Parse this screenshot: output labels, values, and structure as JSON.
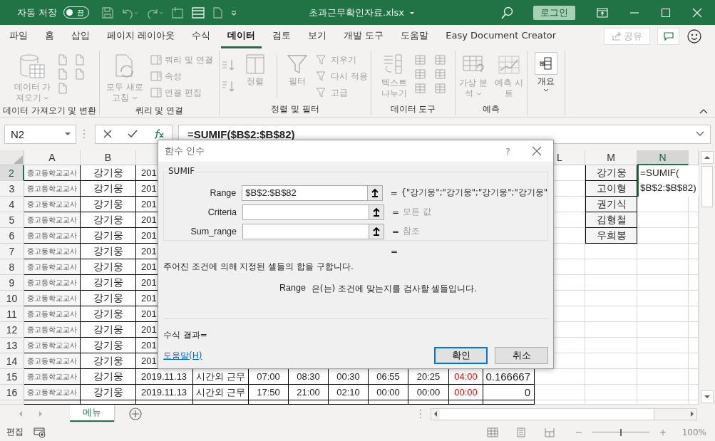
{
  "title_bar": {
    "autosave_label": "자동 저장",
    "autosave_toggle": {
      "label": "끔",
      "on": false
    },
    "file_name": "초과근무확인자료.xlsx",
    "sign_in": "로그인"
  },
  "tabs": [
    {
      "label": "파일",
      "selected": false
    },
    {
      "label": "홈",
      "selected": false
    },
    {
      "label": "삽입",
      "selected": false
    },
    {
      "label": "페이지 레이아웃",
      "selected": false
    },
    {
      "label": "수식",
      "selected": false
    },
    {
      "label": "데이터",
      "selected": true
    },
    {
      "label": "검토",
      "selected": false
    },
    {
      "label": "보기",
      "selected": false
    },
    {
      "label": "개발 도구",
      "selected": false
    },
    {
      "label": "도움말",
      "selected": false
    },
    {
      "label": "Easy Document Creator",
      "selected": false
    }
  ],
  "share_button": {
    "label": "공유",
    "disabled": true
  },
  "ribbon": {
    "get_data": {
      "label": "데이터 가져오기 및 변환",
      "button": {
        "label": "데이터 가져오기",
        "disabled": true
      }
    },
    "queries": {
      "label": "쿼리 및 연결",
      "refresh": {
        "label": "모두 새로 고침",
        "disabled": true
      },
      "items": [
        {
          "label": "쿼리 및 연결",
          "disabled": true
        },
        {
          "label": "속성",
          "disabled": true
        },
        {
          "label": "연결 편집",
          "disabled": true
        }
      ]
    },
    "sort_filter": {
      "label": "정렬 및 필터",
      "sort": {
        "label": "정렬",
        "disabled": true
      },
      "filter": {
        "label": "필터",
        "disabled": true
      },
      "items": [
        {
          "label": "지우기",
          "disabled": true
        },
        {
          "label": "다시 적용",
          "disabled": true
        },
        {
          "label": "고급",
          "disabled": true
        }
      ]
    },
    "data_tools": {
      "label": "데이터 도구",
      "text_to_columns": {
        "label": "텍스트 나누기",
        "disabled": true
      }
    },
    "forecast": {
      "label": "예측",
      "what_if": {
        "label": "가상 분석",
        "disabled": true
      },
      "forecast_sheet": {
        "label": "예측 시트",
        "disabled": true
      }
    },
    "outline": {
      "label": "개요",
      "disabled": false
    }
  },
  "formula_bar": {
    "name_box": "N2",
    "formula": "=**SUMIF($B$2:$B$82)**"
  },
  "columns": [
    {
      "label": "A",
      "selected": false
    },
    {
      "label": "B",
      "selected": false
    },
    {
      "label": "L",
      "selected": false
    },
    {
      "label": "M",
      "selected": false
    },
    {
      "label": "N",
      "selected": true
    }
  ],
  "rows": [
    {
      "num": "2",
      "selected": true,
      "cells": [
        "중고등학교교사",
        "강기웅",
        "201"
      ],
      "m": "강기웅"
    },
    {
      "num": "3",
      "selected": false,
      "cells": [
        "중고등학교교사",
        "강기웅",
        "201"
      ],
      "m": "고이형"
    },
    {
      "num": "4",
      "selected": false,
      "cells": [
        "중고등학교교사",
        "강기웅",
        "201"
      ],
      "m": "권기식"
    },
    {
      "num": "5",
      "selected": false,
      "cells": [
        "중고등학교교사",
        "강기웅",
        "201"
      ],
      "m": "김형철"
    },
    {
      "num": "6",
      "selected": false,
      "cells": [
        "중고등학교교사",
        "강기웅",
        "201"
      ],
      "m": "우희봉"
    },
    {
      "num": "7",
      "selected": false,
      "cells": [
        "중고등학교교사",
        "강기웅",
        "201"
      ]
    },
    {
      "num": "8",
      "selected": false,
      "cells": [
        "중고등학교교사",
        "강기웅",
        "201"
      ]
    },
    {
      "num": "9",
      "selected": false,
      "cells": [
        "중고등학교교사",
        "강기웅",
        "201"
      ]
    },
    {
      "num": "10",
      "selected": false,
      "cells": [
        "중고등학교교사",
        "강기웅",
        "201"
      ]
    },
    {
      "num": "11",
      "selected": false,
      "cells": [
        "중고등학교교사",
        "강기웅",
        "201"
      ]
    },
    {
      "num": "12",
      "selected": false,
      "cells": [
        "중고등학교교사",
        "강기웅",
        "201"
      ]
    },
    {
      "num": "13",
      "selected": false,
      "cells": [
        "중고등학교교사",
        "강기웅",
        "201"
      ]
    },
    {
      "num": "14",
      "selected": false,
      "cells": [
        "중고등학교교사",
        "강기웅",
        "201"
      ]
    },
    {
      "num": "15",
      "selected": false,
      "flagged": true,
      "cells": [
        "중고등학교교사",
        "강기웅",
        "2019.11.13",
        "시간외 근무",
        "07:00",
        "08:30",
        "00:30",
        "06:55",
        "20:25",
        "04:00",
        "0.166667"
      ]
    },
    {
      "num": "16",
      "selected": false,
      "flagged": true,
      "cells": [
        "중고등학교교사",
        "강기웅",
        "2019.11.13",
        "시간외 근무",
        "17:50",
        "21:00",
        "02:10",
        "00:00",
        "00:00",
        "00:00",
        "0"
      ]
    }
  ],
  "cell_editor": {
    "lines": [
      "=SUMIF(",
      "$B$2:$B$82)"
    ]
  },
  "dialog": {
    "title": "함수 인수",
    "help_glyph": "?",
    "function_name": "SUMIF",
    "arguments": [
      {
        "label": "Range",
        "value": "$B$2:$B$82",
        "equals": "=",
        "result": "{\"강기웅\";\"강기웅\";\"강기웅\";\"강기웅\"",
        "dimmed": false
      },
      {
        "label": "Criteria",
        "equals": "=",
        "result": "모든 값",
        "dimmed": true
      },
      {
        "label": "Sum_range",
        "equals": "=",
        "result": "참조",
        "dimmed": true
      }
    ],
    "result_equals": "=",
    "description": "주어진 조건에 의해 지정된 셀들의 합을 구합니다.",
    "arg_name": "Range",
    "arg_help": "은(는) 조건에 맞는지를 검사할 셀들입니다.",
    "formula_result": "수식 결과=",
    "help_link": "도움말(H)",
    "buttons": [
      {
        "label": "확인",
        "default": true
      },
      {
        "label": "취소",
        "default": false
      }
    ]
  },
  "sheet_tabs": [
    {
      "label": "메뉴",
      "selected": true
    }
  ],
  "status_bar": {
    "mode": "편집",
    "zoom": {
      "label": "100%",
      "level": 0.5
    }
  }
}
